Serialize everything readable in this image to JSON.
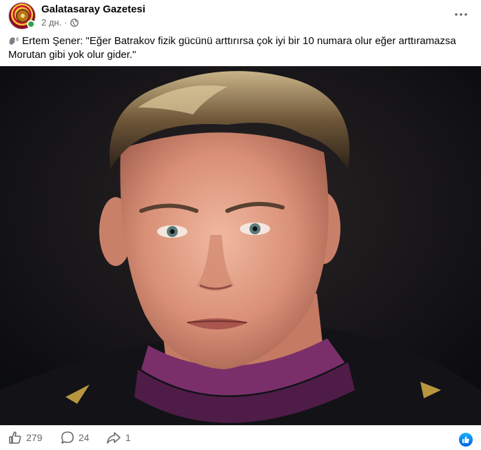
{
  "post": {
    "author": "Galatasaray Gazetesi",
    "time": "2 дн.",
    "separator": "·",
    "text": "Ertem Şener: \"Eğer Batrakov fizik gücünü arttırırsa çok iyi bir 10 numara olur eğer arttıramazsa Morutan gibi yok olur gider.\"",
    "audience_icon": "globe-icon",
    "prefix_icon": "speaking-head-icon"
  },
  "actions": {
    "likes": "279",
    "comments": "24",
    "shares": "1"
  },
  "colors": {
    "secondary_text": "#65676b",
    "online": "#31a24c",
    "reaction_blue": "#0866ff",
    "jersey_purple": "#7a2f6b"
  }
}
